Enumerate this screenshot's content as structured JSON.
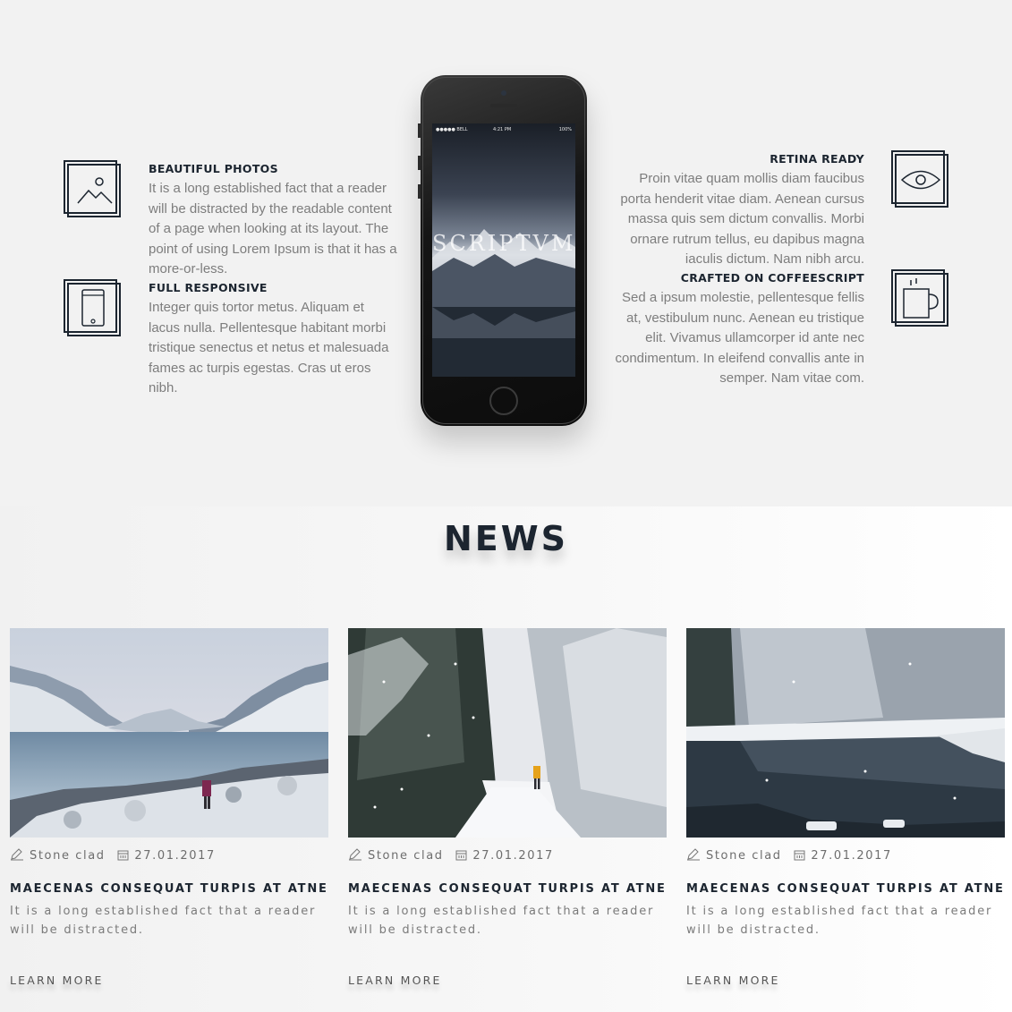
{
  "features": {
    "left": [
      {
        "title": "BEAUTIFUL PHOTOS",
        "text": "It is a long established fact that a reader will be distracted by the readable content of a page when looking at its layout. The point of using Lorem Ipsum is that it has a more-or-less.",
        "icon": "picture-icon"
      },
      {
        "title": "FULL RESPONSIVE",
        "text": "Integer quis tortor metus. Aliquam et lacus nulla. Pellentesque habitant morbi tristique senectus et netus et malesuada fames ac turpis egestas. Cras ut eros nibh.",
        "icon": "mobile-phone-icon"
      }
    ],
    "right": [
      {
        "title": "RETINA READY",
        "text": "Proin vitae quam mollis diam faucibus porta henderit vitae diam. Aenean cursus massa quis sem dictum convallis. Morbi ornare rutrum tellus, eu dapibus magna iaculis dictum. Nam nibh arcu.",
        "icon": "eye-icon"
      },
      {
        "title": "CRAFTED ON COFFEESCRIPT",
        "text": "Sed a ipsum molestie, pellentesque fellis at, vestibulum nunc. Aenean eu tristique elit. Vivamus ullamcorper id ante nec condimentum. In eleifend convallis ante in semper. Nam vitae com.",
        "icon": "coffee-cup-icon"
      }
    ]
  },
  "phone": {
    "carrier": "●●●●● BELL",
    "time": "4:21 PM",
    "battery": "100%",
    "app_name": "SCRIPTVM"
  },
  "news": {
    "title": "NEWS",
    "cards": [
      {
        "author": "Stone clad",
        "date": "27.01.2017",
        "heading": "MAECENAS CONSEQUAT TURPIS AT ATNE",
        "text": "It is a long established fact that a reader will be distracted.",
        "link": "LEARN MORE",
        "image": "frozen-lake-mountains"
      },
      {
        "author": "Stone clad",
        "date": "27.01.2017",
        "heading": "MAECENAS CONSEQUAT TURPIS AT ATNE",
        "text": "It is a long established fact that a reader will be distracted.",
        "link": "LEARN MORE",
        "image": "snowy-forest-path"
      },
      {
        "author": "Stone clad",
        "date": "27.01.2017",
        "heading": "MAECENAS CONSEQUAT TURPIS AT ATNE",
        "text": "It is a long established fact that a reader will be distracted.",
        "link": "LEARN MORE",
        "image": "winter-river-trees"
      }
    ]
  },
  "colors": {
    "heading": "#1c2530",
    "body_text": "#7d7d7d",
    "background": "#f2f2f2"
  }
}
